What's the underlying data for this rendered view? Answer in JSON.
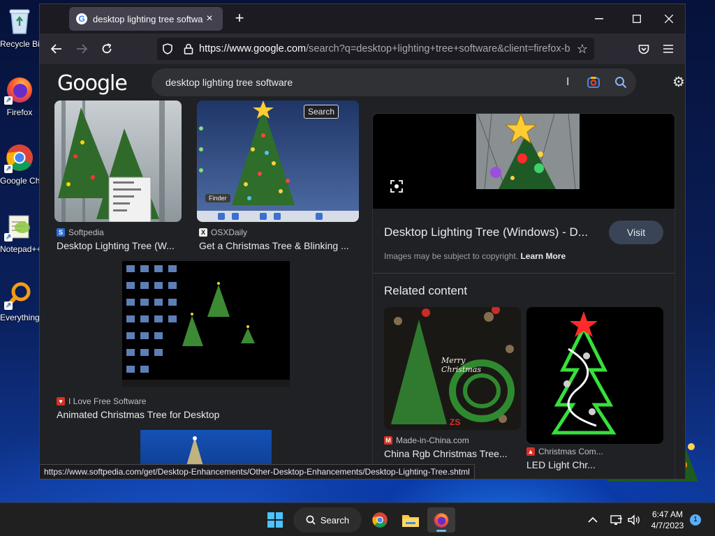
{
  "desktop": {
    "icons": [
      {
        "label": "Recycle Bin"
      },
      {
        "label": "Firefox"
      },
      {
        "label": "Google Chrome"
      },
      {
        "label": "Notepad++"
      },
      {
        "label": "Everything"
      }
    ]
  },
  "browser": {
    "tab_title": "desktop lighting tree software - Google Search",
    "url_host": "https://www.google.com",
    "url_path": "/search?q=desktop+lighting+tree+software&client=firefox-b-d",
    "status_url": "https://www.softpedia.com/get/Desktop-Enhancements/Other-Desktop-Enhancements/Desktop-Lighting-Tree.shtml"
  },
  "google": {
    "logo": "Google",
    "query": "desktop lighting tree software",
    "tooltip": "Search",
    "results": [
      {
        "source": "Softpedia",
        "title": "Desktop Lighting Tree (W..."
      },
      {
        "source": "OSXDaily",
        "title": "Get a Christmas Tree & Blinking ..."
      },
      {
        "source": "I Love Free Software",
        "title": "Animated Christmas Tree for Desktop"
      }
    ],
    "thumb_labels": {
      "osx_finder": "Finder"
    },
    "side": {
      "title": "Desktop Lighting Tree (Windows) - D...",
      "visit": "Visit",
      "copyright": "Images may be subject to copyright.",
      "learn_more": "Learn More",
      "related_heading": "Related content",
      "related": [
        {
          "source": "Made-in-China.com",
          "title": "China Rgb Christmas Tree...",
          "image_text": "Merry Christmas",
          "watermark": "ZS"
        },
        {
          "source": "Christmas Com...",
          "title": "LED Light Chr..."
        }
      ]
    }
  },
  "taskbar": {
    "search_label": "Search",
    "time": "6:47 AM",
    "date": "4/7/2023",
    "notifications": "1"
  }
}
